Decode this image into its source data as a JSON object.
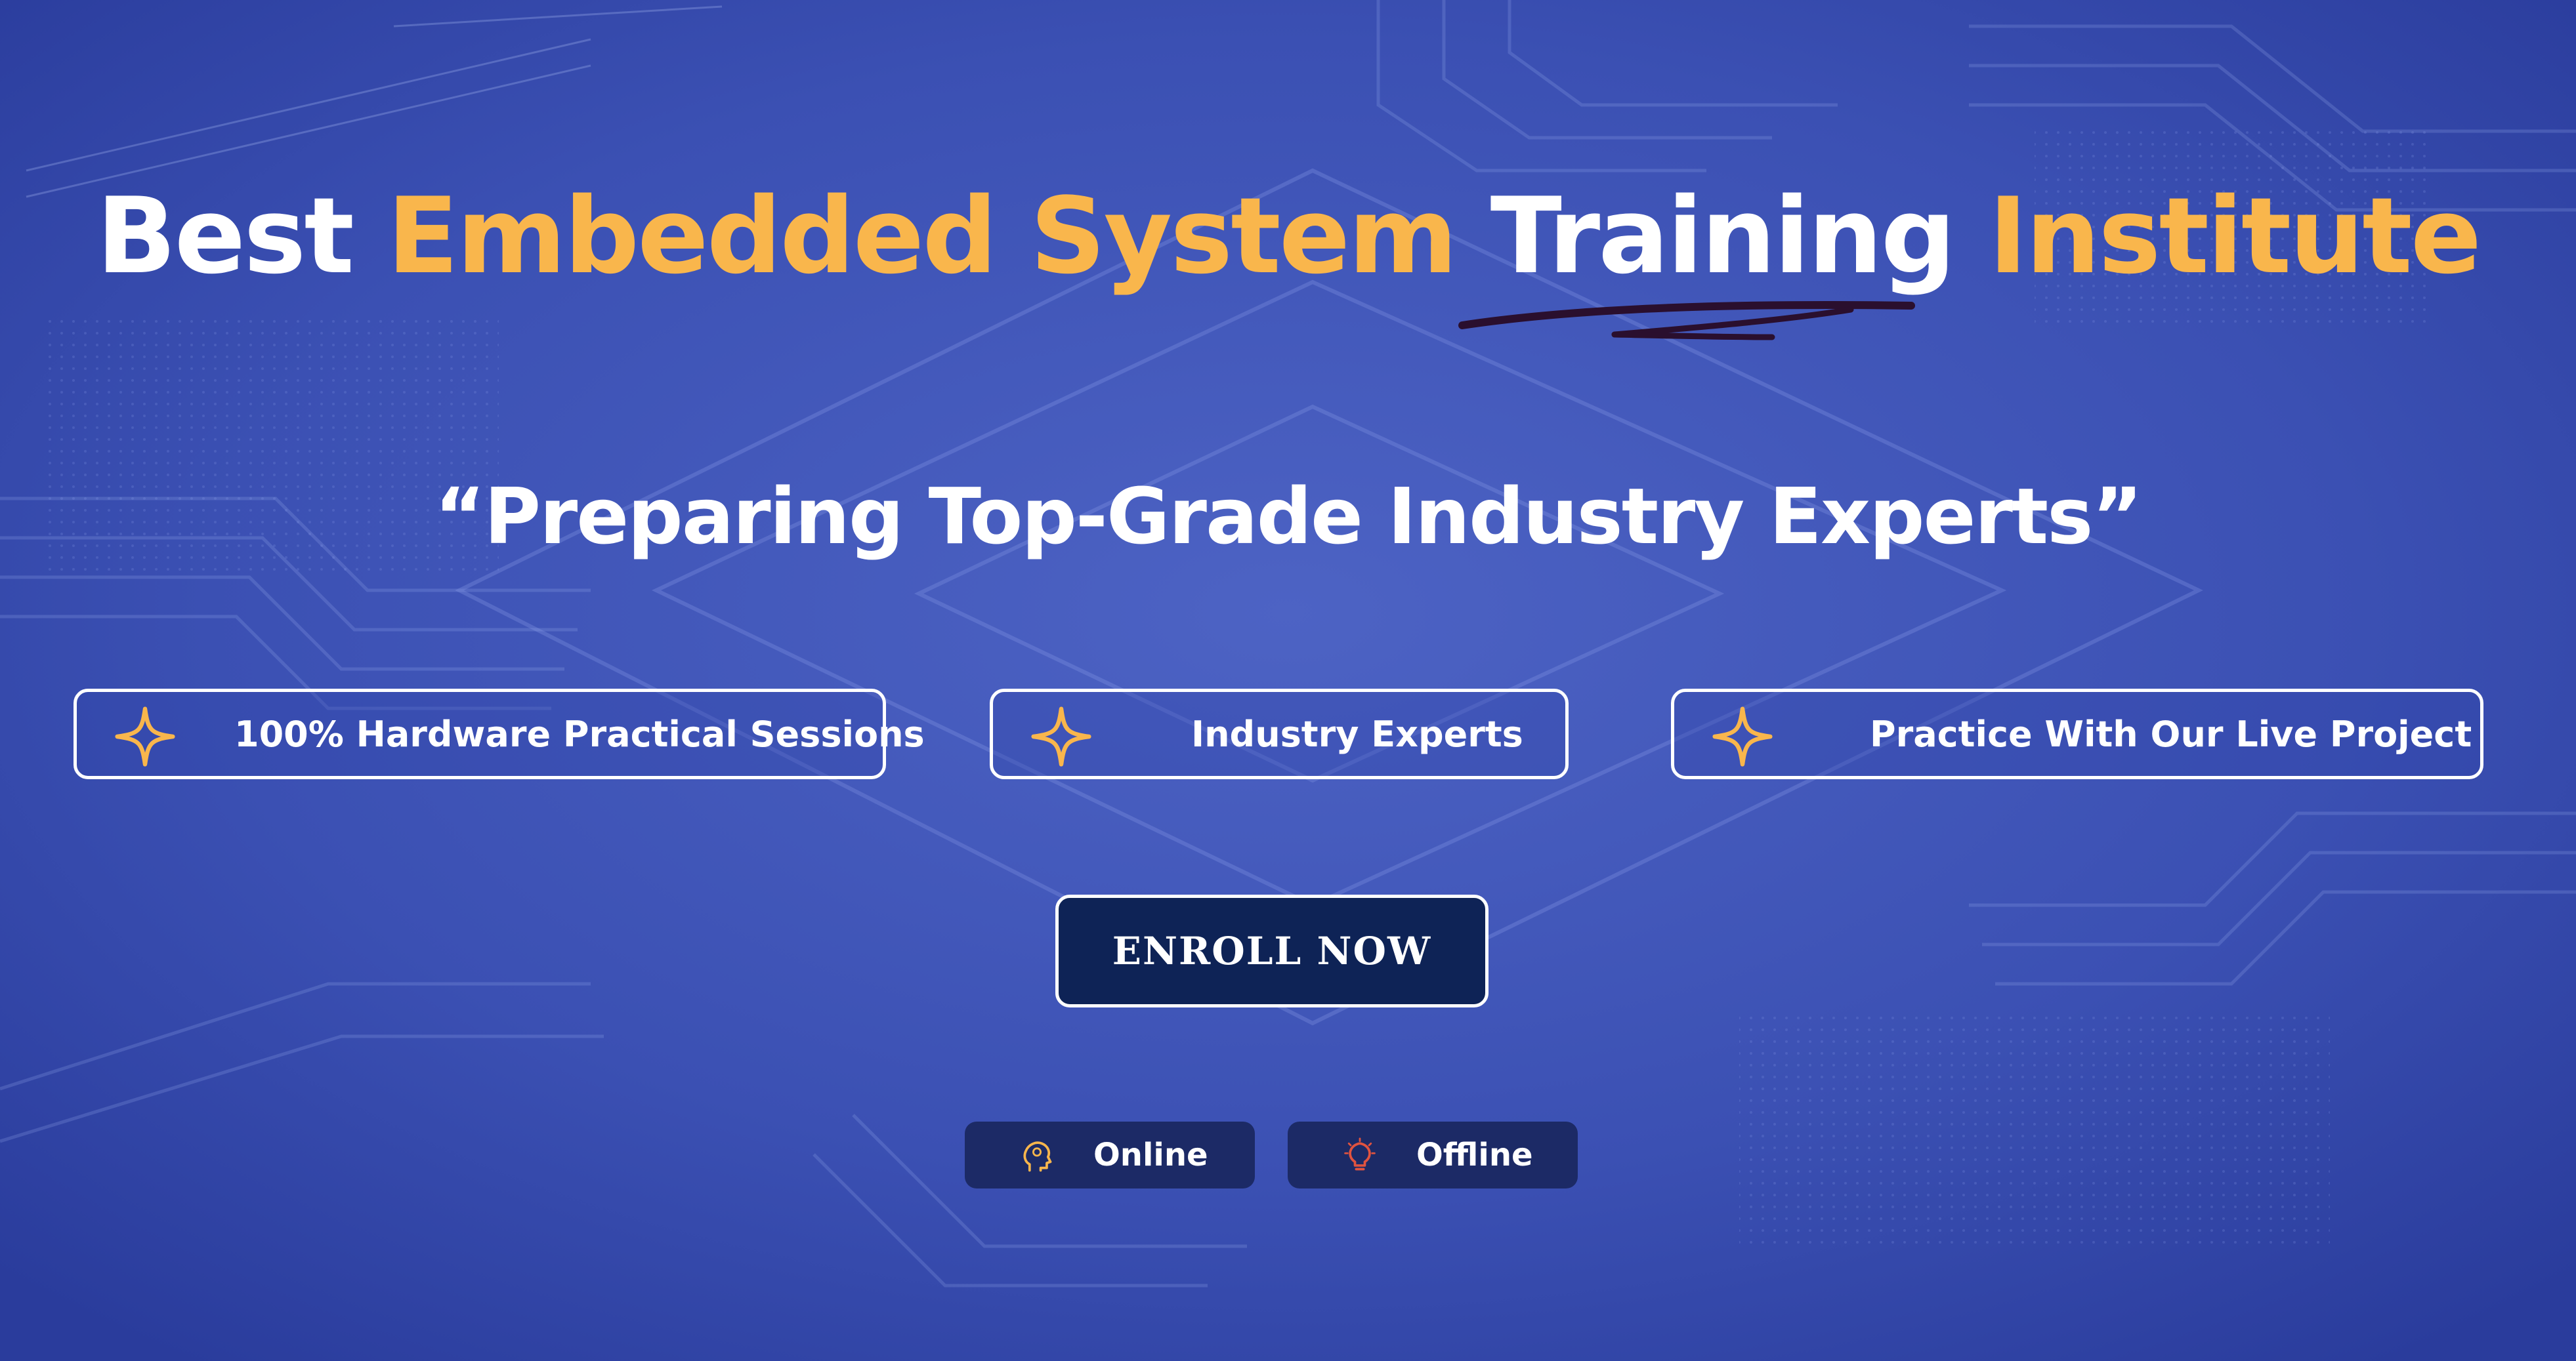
{
  "headline": {
    "word_1": "Best",
    "word_2": "Embedded System",
    "word_3": "Training",
    "word_4": "Institute"
  },
  "tagline": "“Preparing Top-Grade Industry Experts”",
  "features": [
    {
      "label": "100% Hardware Practical Sessions",
      "icon": "four-point-star-icon"
    },
    {
      "label": "Industry Experts",
      "icon": "four-point-star-icon"
    },
    {
      "label": "Practice With Our Live Project",
      "icon": "four-point-star-icon"
    }
  ],
  "cta": {
    "label": "ENROLL NOW"
  },
  "modes": [
    {
      "label": "Online",
      "icon": "head-idea-icon"
    },
    {
      "label": "Offline",
      "icon": "lightbulb-icon"
    }
  ],
  "colors": {
    "background": "#3a4fb0",
    "accent_gold": "#f9b64c",
    "button_navy": "#0e2356",
    "pill_bg": "#1c2a66",
    "offline_icon": "#e0533f"
  }
}
